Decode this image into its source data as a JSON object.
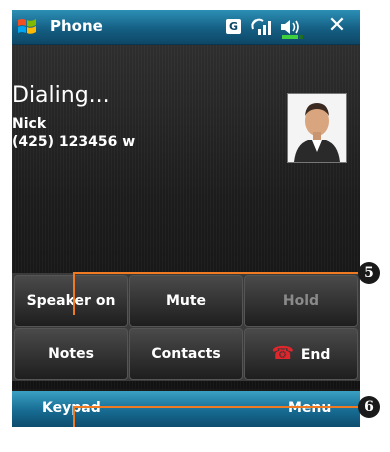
{
  "titlebar": {
    "app_title": "Phone",
    "status_g": "G"
  },
  "call": {
    "status": "Dialing...",
    "contact_name": "Nick",
    "contact_number": "(425) 123456 w"
  },
  "buttons": {
    "speaker": "Speaker on",
    "mute": "Mute",
    "hold": "Hold",
    "notes": "Notes",
    "contacts": "Contacts",
    "end": "End"
  },
  "softkeys": {
    "left": "Keypad",
    "right": "Menu"
  },
  "callouts": {
    "five": "5",
    "six": "6"
  },
  "colors": {
    "accent_callout": "#ef7a21",
    "titlebar": "#155f84",
    "end_icon": "#e0262b"
  }
}
